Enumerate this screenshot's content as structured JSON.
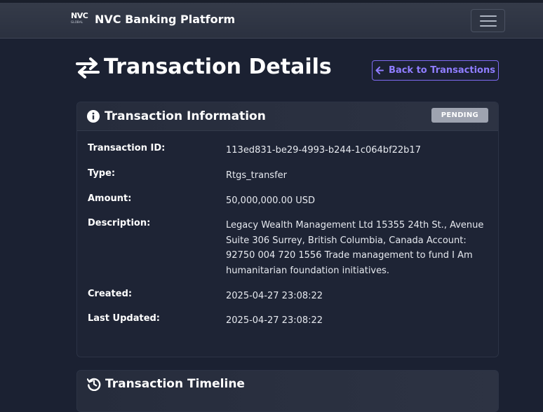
{
  "navbar": {
    "logo_text": "NVC",
    "logo_subtext": "GLOBAL",
    "brand_name": "NVC Banking Platform",
    "toggler_icon": "hamburger-menu-icon"
  },
  "page": {
    "title": "Transaction Details",
    "title_icon": "exchange-arrows-icon",
    "back_label": "Back to Transactions"
  },
  "info_card": {
    "title": "Transaction Information",
    "status": "PENDING",
    "fields": [
      {
        "label": "Transaction ID:",
        "value": "113ed831-be29-4993-b244-1c064bf22b17"
      },
      {
        "label": "Type:",
        "value": "Rtgs_transfer"
      },
      {
        "label": "Amount:",
        "value": "50,000,000.00 USD"
      },
      {
        "label": "Description:",
        "value": "Legacy Wealth Management Ltd 15355 24th St., Avenue Suite 306 Surrey, British Columbia, Canada Account: 92750 004 720 1556 Trade management to fund I Am humanitarian foundation initiatives."
      },
      {
        "label": "Created:",
        "value": "2025-04-27 23:08:22"
      },
      {
        "label": "Last Updated:",
        "value": "2025-04-27 23:08:22"
      }
    ]
  },
  "timeline_card": {
    "title": "Transaction Timeline"
  },
  "colors": {
    "background": "#1b2132",
    "accent": "#8f7dff",
    "badge_pending": "#9ea3b0"
  }
}
